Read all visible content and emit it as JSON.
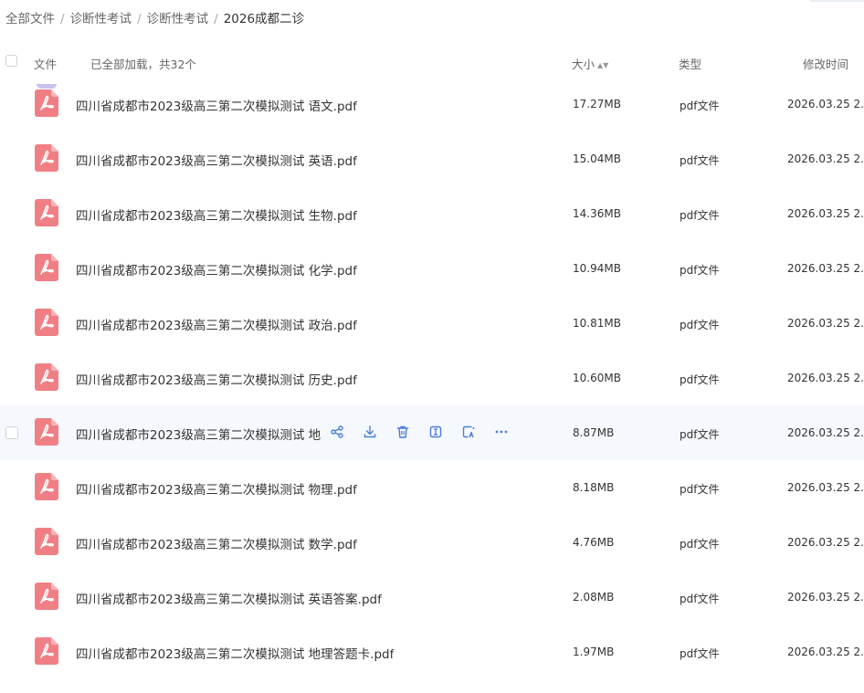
{
  "breadcrumb": [
    "全部文件",
    "诊断性考试",
    "诊断性考试",
    "2026成都二诊"
  ],
  "header": {
    "file_label": "文件",
    "loaded_status": "已全部加载，共32个",
    "size_label": "大小",
    "type_label": "类型",
    "modified_label": "修改时间"
  },
  "files": [
    {
      "name": "四川省成都市2023级高三第二次模拟测试 语文.pdf",
      "size": "17.27MB",
      "type": "pdf文件",
      "modified": "2026.03.25 2..."
    },
    {
      "name": "四川省成都市2023级高三第二次模拟测试 英语.pdf",
      "size": "15.04MB",
      "type": "pdf文件",
      "modified": "2026.03.25 2..."
    },
    {
      "name": "四川省成都市2023级高三第二次模拟测试 生物.pdf",
      "size": "14.36MB",
      "type": "pdf文件",
      "modified": "2026.03.25 2..."
    },
    {
      "name": "四川省成都市2023级高三第二次模拟测试 化学.pdf",
      "size": "10.94MB",
      "type": "pdf文件",
      "modified": "2026.03.25 2..."
    },
    {
      "name": "四川省成都市2023级高三第二次模拟测试 政治.pdf",
      "size": "10.81MB",
      "type": "pdf文件",
      "modified": "2026.03.25 2..."
    },
    {
      "name": "四川省成都市2023级高三第二次模拟测试 历史.pdf",
      "size": "10.60MB",
      "type": "pdf文件",
      "modified": "2026.03.25 2..."
    },
    {
      "name": "四川省成都市2023级高三第二次模拟测试 地",
      "size": "8.87MB",
      "type": "pdf文件",
      "modified": "2026.03.25 2..."
    },
    {
      "name": "四川省成都市2023级高三第二次模拟测试 物理.pdf",
      "size": "8.18MB",
      "type": "pdf文件",
      "modified": "2026.03.25 2..."
    },
    {
      "name": "四川省成都市2023级高三第二次模拟测试 数学.pdf",
      "size": "4.76MB",
      "type": "pdf文件",
      "modified": "2026.03.25 2..."
    },
    {
      "name": "四川省成都市2023级高三第二次模拟测试 英语答案.pdf",
      "size": "2.08MB",
      "type": "pdf文件",
      "modified": "2026.03.25 2..."
    },
    {
      "name": "四川省成都市2023级高三第二次模拟测试 地理答题卡.pdf",
      "size": "1.97MB",
      "type": "pdf文件",
      "modified": "2026.03.25 2..."
    }
  ],
  "hovered_row_actions": [
    "share-icon",
    "download-icon",
    "delete-icon",
    "open-icon",
    "ai-icon",
    "more-icon"
  ],
  "colors": {
    "pdf_icon": "#f07f85",
    "action_icon": "#4a7ed9",
    "hover_row": "#f5f8fd"
  }
}
